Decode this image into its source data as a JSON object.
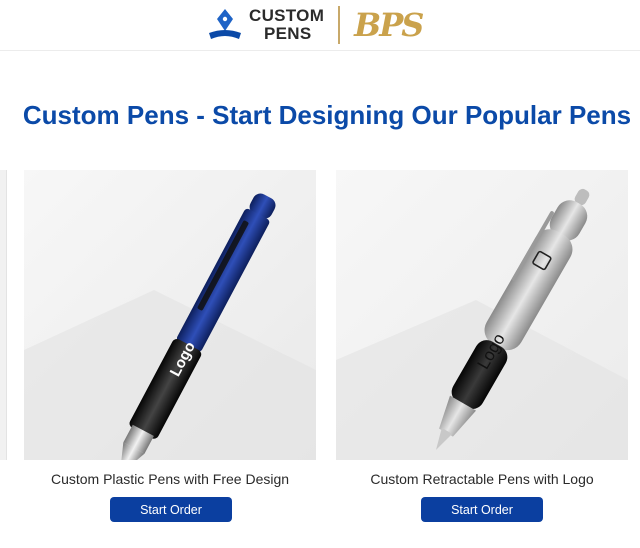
{
  "header": {
    "logo_line1": "CUSTOM",
    "logo_line2": "PENS",
    "partner_logo": "BPS"
  },
  "headline": "Custom Pens - Start Designing Our Popular Pens",
  "products": [
    {
      "caption": "Custom Plastic Pens with Free Design",
      "button": "Start Order",
      "pen_imprint": "Logo",
      "pen_color": "#1f3a8f"
    },
    {
      "caption": "Custom Retractable Pens with Logo",
      "button": "Start Order",
      "pen_imprint": "Logo",
      "pen_color": "#c9c9c9"
    }
  ],
  "colors": {
    "brand_blue": "#0b4aa8",
    "button_blue": "#0b3fa0",
    "gold": "#caa24c"
  }
}
